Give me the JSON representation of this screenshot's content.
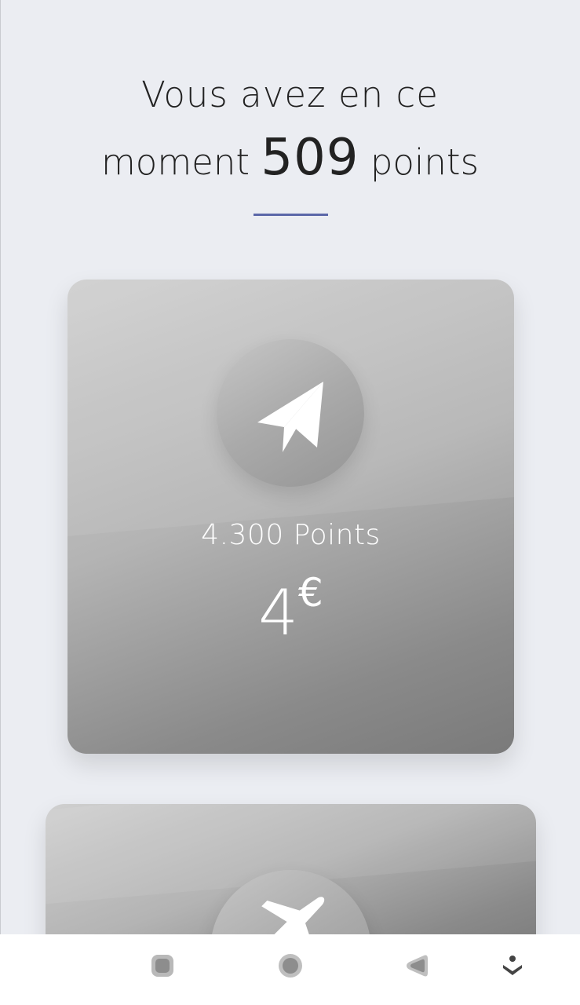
{
  "header": {
    "line1": "Vous avez en ce",
    "prefix": "moment",
    "points_value": "509",
    "suffix": "points"
  },
  "rewards": [
    {
      "icon": "paper-plane-icon",
      "points_label": "4.300 Points",
      "amount": "4",
      "currency": "€"
    },
    {
      "icon": "airplane-icon"
    }
  ],
  "navbar": {
    "icons": [
      "recent-apps-icon",
      "home-icon",
      "back-icon",
      "assistant-icon"
    ]
  },
  "colors": {
    "background": "#ebedf2",
    "accent": "#5b67a8",
    "text": "#222222"
  }
}
